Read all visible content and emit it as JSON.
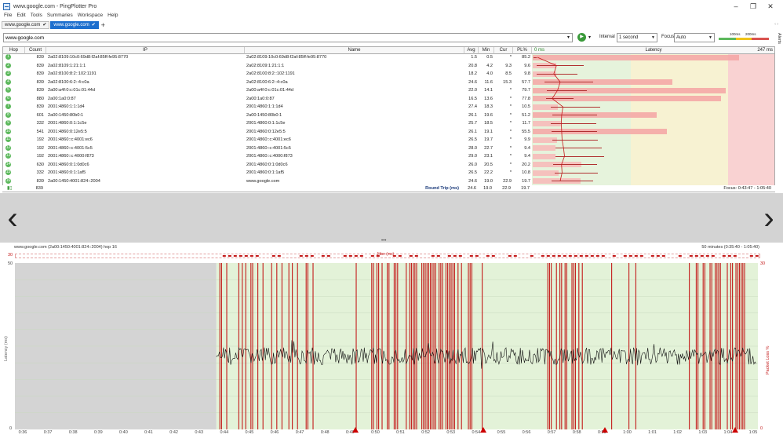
{
  "window": {
    "title": "www.google.com - PingPlotter Pro"
  },
  "menu": [
    "File",
    "Edit",
    "Tools",
    "Summaries",
    "Workspace",
    "Help"
  ],
  "tabs": [
    {
      "label": "www.google.com"
    },
    {
      "label": "www.google.com"
    }
  ],
  "address": {
    "value": "www.google.com"
  },
  "controls": {
    "interval_label": "Interval",
    "interval_value": "1 second",
    "focus_label": "Focus",
    "focus_value": "Auto",
    "legend_100": "100ms",
    "legend_200": "200ms",
    "alerts": "Alerts"
  },
  "grid": {
    "headers": {
      "hop": "Hop",
      "count": "Count",
      "ip": "IP",
      "name": "Name",
      "avg": "Avg",
      "min": "Min",
      "cur": "Cur",
      "pl": "PL%",
      "zero": "0 ms",
      "latency": "Latency",
      "max": "247 ms"
    },
    "rows": [
      {
        "hop": "1",
        "count": "839",
        "ip": "2a02:8109:10c0:69d8:f2af:85ff:fe95:8770",
        "name": "2a02:8109:10c0:69d8:f2af:85ff:fe95:8770",
        "avg": "1.5",
        "min": "0.5",
        "cur": "*",
        "pl": "85.2"
      },
      {
        "hop": "2",
        "count": "839",
        "ip": "2a02:8109:1:21:1:1",
        "name": "2a02:8109:1:21:1:1",
        "avg": "20.8",
        "min": "4.2",
        "cur": "9.3",
        "pl": "9.6"
      },
      {
        "hop": "3",
        "count": "839",
        "ip": "2a02:8100:8:2::102:1191",
        "name": "2a02:8100:8:2::102:1191",
        "avg": "18.2",
        "min": "4.0",
        "cur": "8.5",
        "pl": "9.8"
      },
      {
        "hop": "4",
        "count": "839",
        "ip": "2a02:8100:6:2::4:c0a",
        "name": "2a02:8100:6:2::4:c0a",
        "avg": "24.6",
        "min": "11.6",
        "cur": "15.3",
        "pl": "57.7"
      },
      {
        "hop": "5",
        "count": "839",
        "ip": "2a00:a4f:0:c:01c:01:44d",
        "name": "2a00:a4f:0:c:01c:01:44d",
        "avg": "22.0",
        "min": "14.1",
        "cur": "*",
        "pl": "79.7"
      },
      {
        "hop": "6",
        "count": "880",
        "ip": "2a00:1a0:0:87",
        "name": "2a00:1a0:0:87",
        "avg": "16.5",
        "min": "13.6",
        "cur": "*",
        "pl": "77.8"
      },
      {
        "hop": "7",
        "count": "839",
        "ip": "2001:4860:1:1:1d4",
        "name": "2001:4860:1:1:1d4",
        "avg": "27.4",
        "min": "18.3",
        "cur": "*",
        "pl": "10.5"
      },
      {
        "hop": "8",
        "count": "601",
        "ip": "2a00:1450:80b0:1",
        "name": "2a00:1450:80b0:1",
        "avg": "26.1",
        "min": "19.6",
        "cur": "*",
        "pl": "51.2"
      },
      {
        "hop": "9",
        "count": "332",
        "ip": "2001:4860:0:1:1c5e",
        "name": "2001:4860:0:1:1c5e",
        "avg": "25.7",
        "min": "18.5",
        "cur": "*",
        "pl": "11.7"
      },
      {
        "hop": "10",
        "count": "541",
        "ip": "2001:4860:0:12e5:5",
        "name": "2001:4860:0:12e5:5",
        "avg": "26.1",
        "min": "19.1",
        "cur": "*",
        "pl": "55.5"
      },
      {
        "hop": "11",
        "count": "192",
        "ip": "2001:4860::c:4001:ec6",
        "name": "2001:4860::c:4001:ec6",
        "avg": "26.5",
        "min": "19.7",
        "cur": "*",
        "pl": "9.9"
      },
      {
        "hop": "12",
        "count": "192",
        "ip": "2001:4860::c:4001:5c5",
        "name": "2001:4860::c:4001:5c5",
        "avg": "28.0",
        "min": "22.7",
        "cur": "*",
        "pl": "9.4"
      },
      {
        "hop": "13",
        "count": "192",
        "ip": "2001:4860::c:4000:f873",
        "name": "2001:4860::c:4000:f873",
        "avg": "29.0",
        "min": "23.1",
        "cur": "*",
        "pl": "9.4"
      },
      {
        "hop": "14",
        "count": "630",
        "ip": "2001:4860:0:1:0d0c6",
        "name": "2001:4860:0:1:0d0c6",
        "avg": "26.0",
        "min": "20.5",
        "cur": "*",
        "pl": "20.2"
      },
      {
        "hop": "15",
        "count": "332",
        "ip": "2001:4860:0:1:1af5",
        "name": "2001:4860:0:1:1af5",
        "avg": "26.5",
        "min": "22.2",
        "cur": "*",
        "pl": "10.8"
      },
      {
        "hop": "16",
        "count": "839",
        "ip": "2a00:1450:4001:824::2004",
        "name": "www.google.com",
        "avg": "24.6",
        "min": "19.0",
        "cur": "22.9",
        "pl": "19.7"
      }
    ],
    "summary": {
      "count": "839",
      "label": "Round Trip (ms)",
      "avg": "24.6",
      "min": "19.0",
      "cur": "22.9",
      "pl": "19.7",
      "focus": "Focus: 0:43:47 - 1:05:40"
    }
  },
  "graph": {
    "header_left": "www.google.com (2a00:1450:4001:824::2004) hop 16",
    "header_right": "50 minutes (0:35:40 - 1:05:40)",
    "jitter_label": "Jitter (ms)",
    "y_label": "Latency (ms)",
    "y2_label": "Packet Loss %",
    "y_top": "50",
    "y_bottom": "0",
    "y2_top": "30",
    "y2_bottom": "0",
    "jitter_top": "30",
    "time_ticks": [
      "0:36",
      "0:37",
      "0:38",
      "0:39",
      "0:40",
      "0:41",
      "0:42",
      "0:43",
      "0:44",
      "0:45",
      "0:46",
      "0:47",
      "0:48",
      "0:49",
      "0:50",
      "0:51",
      "0:52",
      "0:53",
      "0:54",
      "0:55",
      "0:56",
      "0:57",
      "0:58",
      "0:59",
      "1:00",
      "1:01",
      "1:02",
      "1:03",
      "1:04",
      "1:05"
    ]
  },
  "colors": {
    "green": "#5cb85c",
    "loss": "#c41a1a",
    "pink": "#f7b7b7",
    "bgGreen": "#e3f2d8",
    "bgYellow": "#f6f1d0",
    "bgRed": "#f9cfcf",
    "accent": "#1d6fce"
  }
}
